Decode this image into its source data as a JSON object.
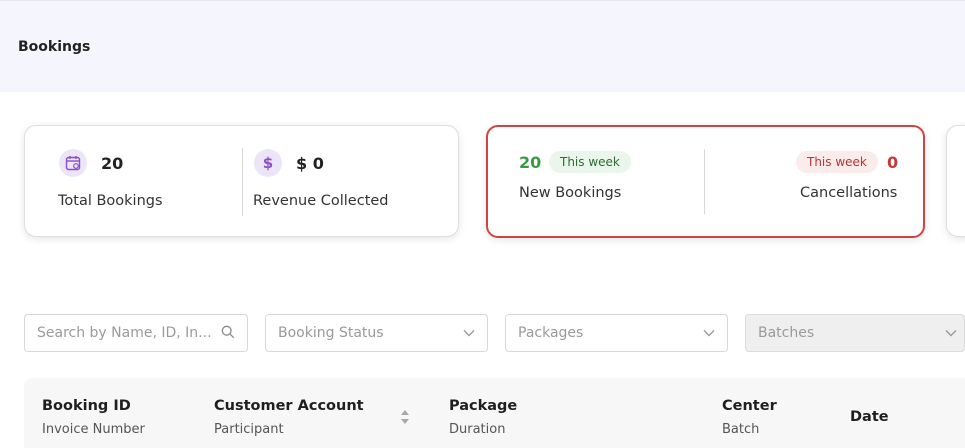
{
  "header": {
    "title": "Bookings"
  },
  "stats": {
    "total_bookings": {
      "value": "20",
      "label": "Total Bookings"
    },
    "revenue": {
      "value": "$ 0",
      "label": "Revenue Collected"
    },
    "new_bookings": {
      "value": "20",
      "badge": "This week",
      "label": "New Bookings"
    },
    "cancellations": {
      "value": "0",
      "badge": "This week",
      "label": "Cancellations"
    }
  },
  "filters": {
    "search_placeholder": "Search by Name, ID, In...",
    "booking_status": "Booking Status",
    "packages": "Packages",
    "batches": "Batches"
  },
  "table": {
    "columns": [
      {
        "main": "Booking ID",
        "sub": "Invoice Number"
      },
      {
        "main": "Customer Account",
        "sub": "Participant"
      },
      {
        "main": "Package",
        "sub": "Duration"
      },
      {
        "main": "Center",
        "sub": "Batch"
      },
      {
        "main": "Date",
        "sub": ""
      }
    ]
  },
  "colors": {
    "accent_purple": "#8a4fc9",
    "positive_green": "#3a9a48",
    "negative_red": "#c43a3a",
    "highlight_border": "#d04343"
  }
}
